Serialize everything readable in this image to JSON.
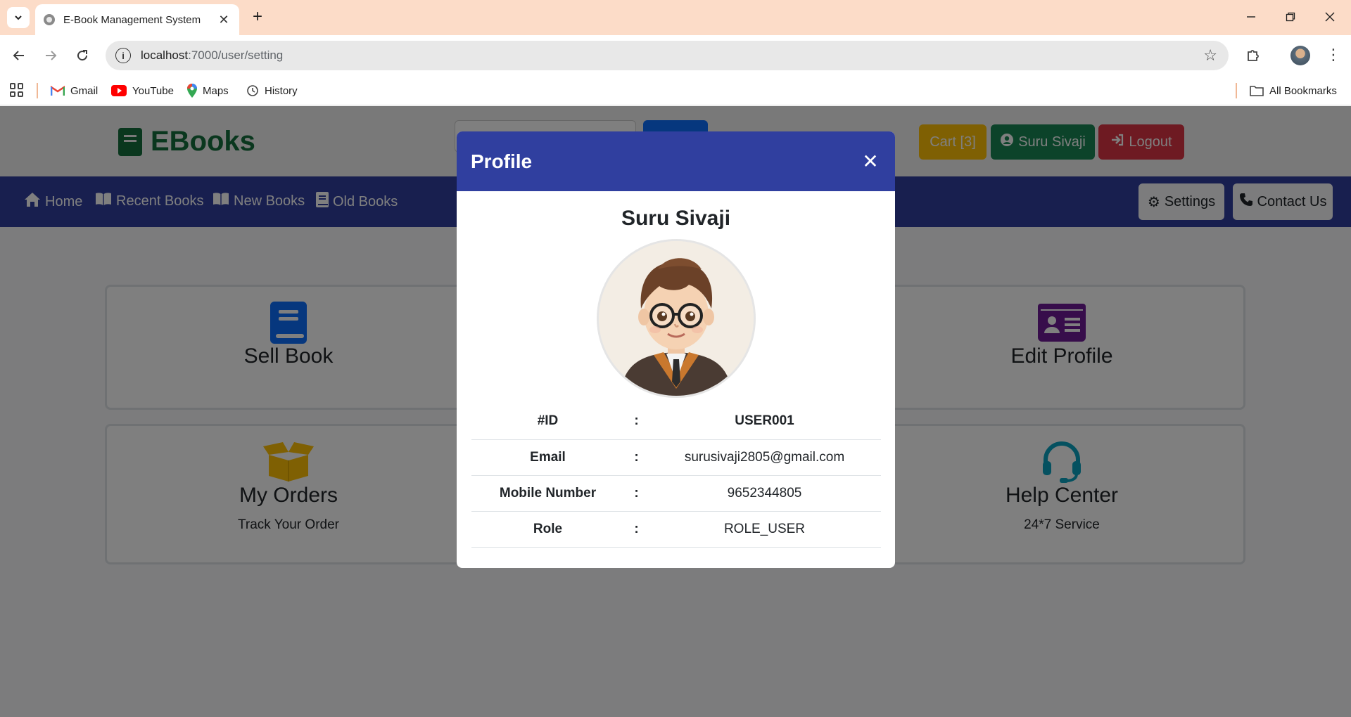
{
  "browser": {
    "tab_title": "E-Book Management System",
    "url_host": "localhost",
    "url_rest": ":7000/user/setting",
    "bookmarks": [
      "Gmail",
      "YouTube",
      "Maps",
      "History"
    ],
    "all_bookmarks": "All Bookmarks"
  },
  "header": {
    "logo": "EBooks",
    "cart": "Cart [3]",
    "user": "Suru Sivaji",
    "logout": "Logout"
  },
  "nav": {
    "home": "Home",
    "recent": "Recent Books",
    "new": "New Books",
    "old": "Old Books",
    "settings": "Settings",
    "contact": "Contact Us"
  },
  "cards": {
    "sell_book": "Sell Book",
    "edit_profile": "Edit Profile",
    "my_orders": "My Orders",
    "my_orders_sub": "Track Your Order",
    "help_center": "Help Center",
    "help_center_sub": "24*7 Service"
  },
  "modal": {
    "title": "Profile",
    "name": "Suru Sivaji",
    "rows": [
      {
        "label": "#ID",
        "sep": ":",
        "value": "USER001"
      },
      {
        "label": "Email",
        "sep": ":",
        "value": "surusivaji2805@gmail.com"
      },
      {
        "label": "Mobile Number",
        "sep": ":",
        "value": "9652344805"
      },
      {
        "label": "Role",
        "sep": ":",
        "value": "ROLE_USER"
      }
    ]
  },
  "colors": {
    "primary_nav": "#303f9f",
    "logo_green": "#156f3d",
    "cart_yellow": "#ffc107",
    "user_green": "#198754",
    "logout_red": "#dc3545",
    "sell_blue": "#0d6efd",
    "edit_purple": "#6f1a96",
    "orders_yellow": "#ffc107",
    "help_teal": "#0aa2c0"
  }
}
